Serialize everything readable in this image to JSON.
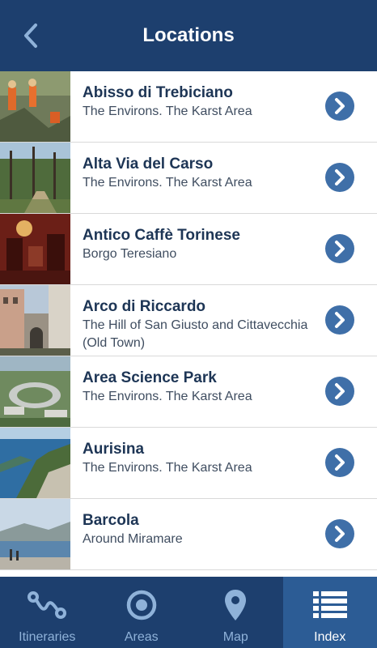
{
  "header": {
    "title": "Locations",
    "back_icon": "chevron-left-icon"
  },
  "locations": [
    {
      "name": "Abisso di Trebiciano",
      "area": "The Environs. The Karst Area",
      "thumb": "cave-rescue-photo"
    },
    {
      "name": "Alta Via del Carso",
      "area": "The Environs. The Karst Area",
      "thumb": "forest-path-photo"
    },
    {
      "name": "Antico Caffè Torinese",
      "area": "Borgo Teresiano",
      "thumb": "cafe-interior-photo"
    },
    {
      "name": "Arco di Riccardo",
      "area": "The Hill of San Giusto and Cittavecchia (Old Town)",
      "thumb": "roman-arch-photo"
    },
    {
      "name": "Area Science Park",
      "area": "The Environs. The Karst Area",
      "thumb": "science-park-aerial-photo"
    },
    {
      "name": "Aurisina",
      "area": "The Environs. The Karst Area",
      "thumb": "coast-cliffs-photo"
    },
    {
      "name": "Barcola",
      "area": "Around Miramare",
      "thumb": "seafront-photo"
    }
  ],
  "tabs": [
    {
      "label": "Itineraries",
      "icon": "route-icon",
      "active": false
    },
    {
      "label": "Areas",
      "icon": "target-icon",
      "active": false
    },
    {
      "label": "Map",
      "icon": "map-pin-icon",
      "active": false
    },
    {
      "label": "Index",
      "icon": "list-icon",
      "active": true
    }
  ],
  "colors": {
    "header_bg": "#1d3f6e",
    "active_tab_bg": "#2c5c95",
    "chevron_circle": "#3f6fa8",
    "title_text": "#1d3555",
    "inactive_tab_text": "#8fb2d9"
  }
}
